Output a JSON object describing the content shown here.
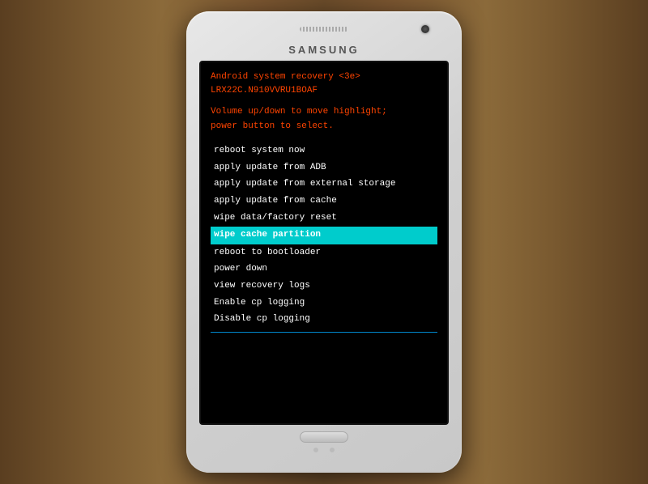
{
  "background": {
    "color": "#6b4c2a"
  },
  "phone": {
    "brand": "SAMSUNG",
    "screen": {
      "header": {
        "line1": "Android system recovery <3e>",
        "line2": "LRX22C.N910VVRU1BOAF"
      },
      "instructions": {
        "line1": "Volume up/down to move highlight;",
        "line2": "power button to select."
      },
      "menu_items": [
        {
          "label": "reboot system now",
          "selected": false
        },
        {
          "label": "apply update from ADB",
          "selected": false
        },
        {
          "label": "apply update from external storage",
          "selected": false
        },
        {
          "label": "apply update from cache",
          "selected": false
        },
        {
          "label": "wipe data/factory reset",
          "selected": false
        },
        {
          "label": "wipe cache partition",
          "selected": true
        },
        {
          "label": "reboot to bootloader",
          "selected": false
        },
        {
          "label": "power down",
          "selected": false
        },
        {
          "label": "view recovery logs",
          "selected": false
        },
        {
          "label": "Enable cp logging",
          "selected": false
        },
        {
          "label": "Disable cp logging",
          "selected": false
        }
      ]
    }
  }
}
